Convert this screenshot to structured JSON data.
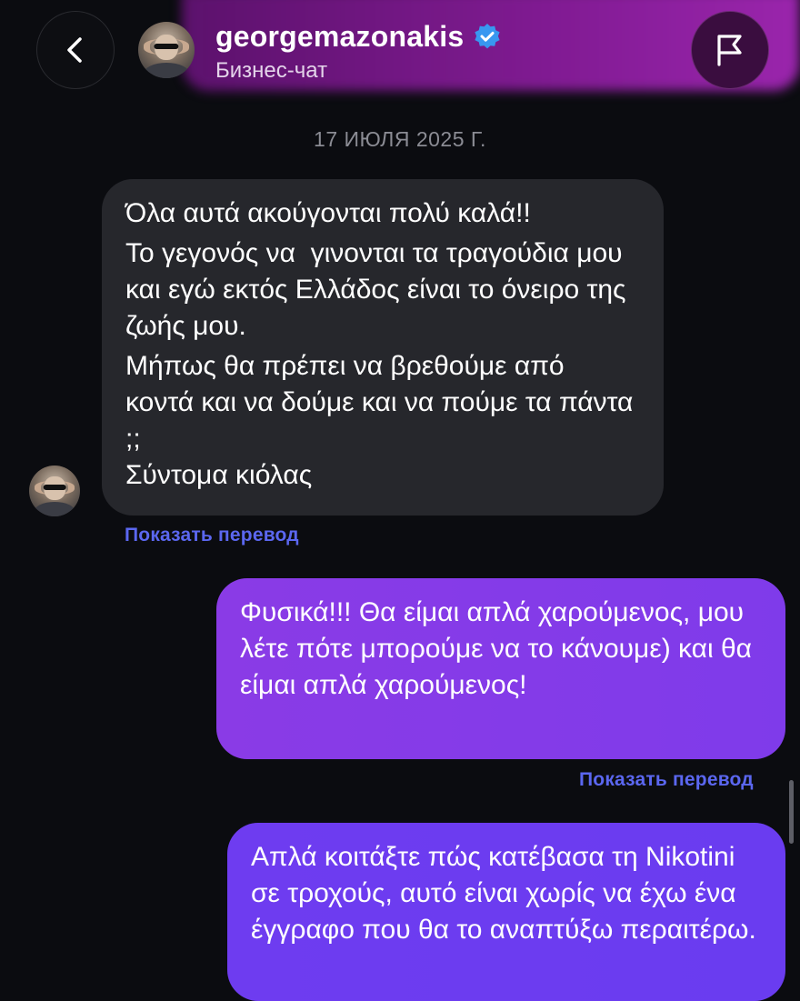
{
  "header": {
    "username": "georgemazonakis",
    "subtitle": "Бизнес-чат",
    "verified": true,
    "accent": "#a22cc0"
  },
  "chat": {
    "date_separator": "17 ИЮЛЯ 2025 Г.",
    "incoming": {
      "paragraphs": [
        "Όλα αυτά ακούγονται πολύ καλά!!",
        "Το γεγονός να  γινονται τα τραγούδια μου και εγώ εκτός Ελλάδος είναι το όνειρο της ζωής μου.",
        "Μήπως θα πρέπει να βρεθούμε από κοντά και να δούμε και να πούμε τα πάντα ;;\nΣύντομα κιόλας"
      ],
      "translate_label": "Показать перевод"
    },
    "outgoing": [
      {
        "text": "Φυσικά!!! Θα είμαι απλά χαρούμενος, μου λέτε πότε μπορούμε να το κάνουμε) και θα είμαι απλά χαρούμενος!",
        "translate_label": "Показать перевод"
      },
      {
        "text": "Απλά κοιτάξτε πώς κατέβασα τη Nikotini σε τροχούς, αυτό είναι χωρίς να έχω ένα έγγραφο που θα το αναπτύξω περαιτέρω."
      }
    ]
  },
  "icons": {
    "back": "chevron-left-icon",
    "report": "flag-icon",
    "verified": "verified-badge-icon"
  },
  "colors": {
    "background": "#0b0c10",
    "incoming_bubble": "#26272c",
    "outgoing_bubble": "#7f3bea",
    "link": "#5b67f0"
  }
}
